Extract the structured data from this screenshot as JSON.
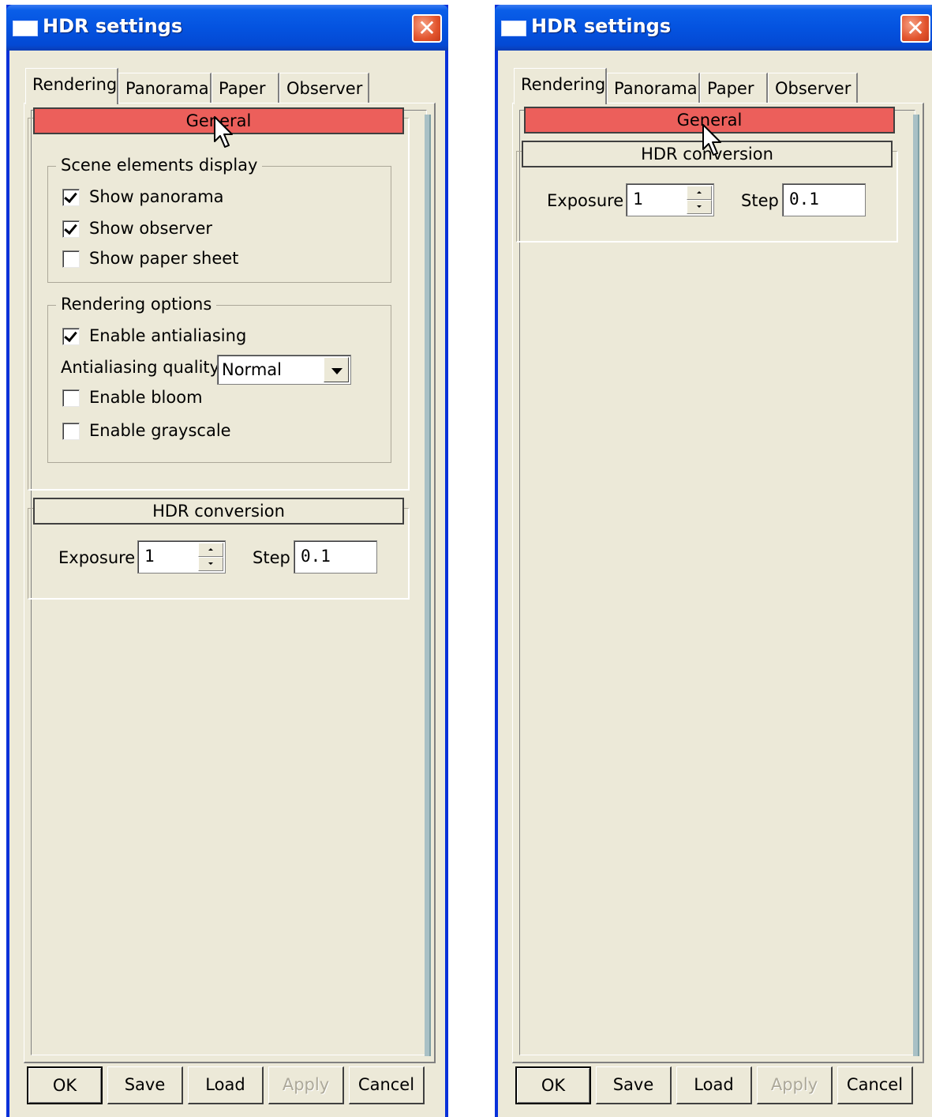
{
  "windows": [
    {
      "title": "HDR settings",
      "close_glyph": "✕",
      "tabs": [
        "Rendering",
        "Panorama",
        "Paper",
        "Observer"
      ],
      "active_tab": "Rendering",
      "sections": {
        "general": {
          "label": "General",
          "expanded": true,
          "scene_group": {
            "label": "Scene elements display",
            "show_panorama": {
              "label": "Show panorama",
              "checked": true
            },
            "show_observer": {
              "label": "Show observer",
              "checked": true
            },
            "show_paper": {
              "label": "Show paper sheet",
              "checked": false
            }
          },
          "render_group": {
            "label": "Rendering options",
            "antialiasing": {
              "label": "Enable antialiasing",
              "checked": true
            },
            "aa_quality_label": "Antialiasing quality",
            "aa_quality_value": "Normal",
            "bloom": {
              "label": "Enable bloom",
              "checked": false
            },
            "grayscale": {
              "label": "Enable grayscale",
              "checked": false
            }
          }
        },
        "hdr": {
          "label": "HDR conversion",
          "exposure_label": "Exposure",
          "exposure_value": "1",
          "step_label": "Step",
          "step_value": "0.1"
        }
      },
      "buttons": {
        "ok": "OK",
        "save": "Save",
        "load": "Load",
        "apply": "Apply",
        "cancel": "Cancel"
      },
      "icons": {
        "title": "window-icon",
        "close": "close-icon",
        "cursor": "mouse-pointer-icon"
      }
    },
    {
      "title": "HDR settings",
      "close_glyph": "✕",
      "tabs": [
        "Rendering",
        "Panorama",
        "Paper",
        "Observer"
      ],
      "active_tab": "Rendering",
      "sections": {
        "general": {
          "label": "General",
          "expanded": false
        },
        "hdr": {
          "label": "HDR conversion",
          "exposure_label": "Exposure",
          "exposure_value": "1",
          "step_label": "Step",
          "step_value": "0.1"
        }
      },
      "buttons": {
        "ok": "OK",
        "save": "Save",
        "load": "Load",
        "apply": "Apply",
        "cancel": "Cancel"
      },
      "icons": {
        "title": "window-icon",
        "close": "close-icon",
        "cursor": "mouse-pointer-icon"
      }
    }
  ],
  "colors": {
    "title_bar": "#0453e0",
    "general_header": "#ec5f5b",
    "dialog_face": "#ece9d8",
    "close_button": "#e2542d"
  }
}
